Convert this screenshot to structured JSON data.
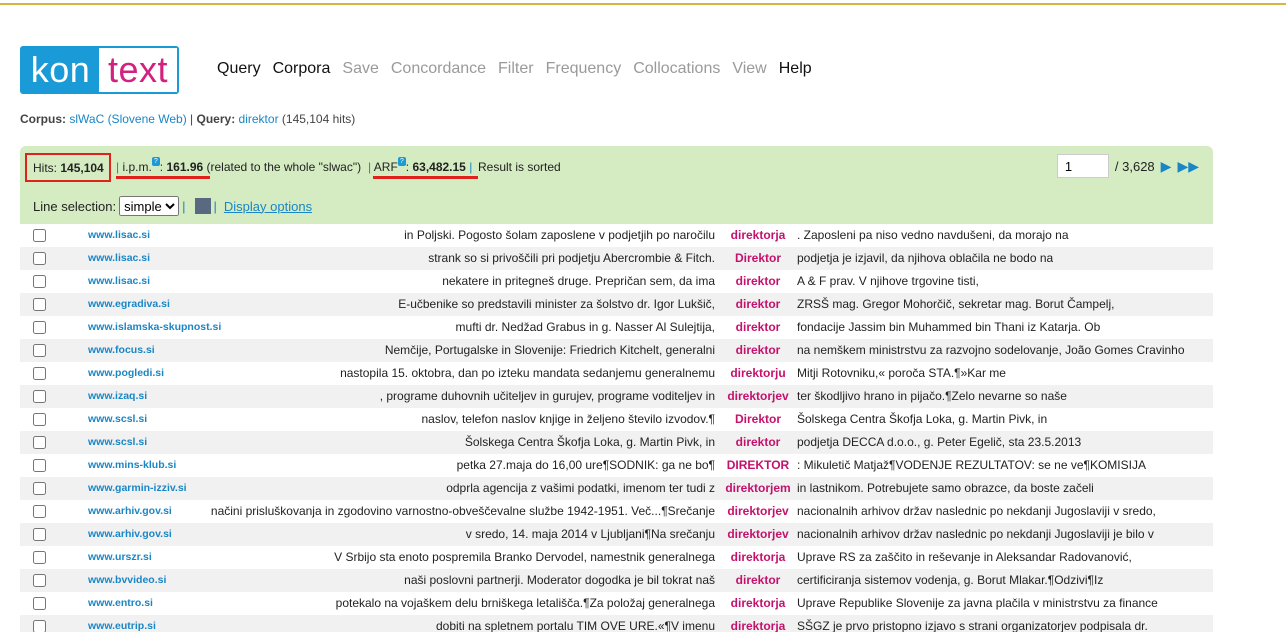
{
  "logo": {
    "part1": "kon",
    "part2": "text"
  },
  "nav": [
    {
      "label": "Query",
      "enabled": true
    },
    {
      "label": "Corpora",
      "enabled": true
    },
    {
      "label": "Save",
      "enabled": false
    },
    {
      "label": "Concordance",
      "enabled": false
    },
    {
      "label": "Filter",
      "enabled": false
    },
    {
      "label": "Frequency",
      "enabled": false
    },
    {
      "label": "Collocations",
      "enabled": false
    },
    {
      "label": "View",
      "enabled": false
    },
    {
      "label": "Help",
      "enabled": true
    }
  ],
  "crumb": {
    "corpus_label": "Corpus:",
    "corpus_value": "slWaC (Slovene Web)",
    "sep": " | ",
    "query_label": "Query:",
    "query_value": "direktor",
    "hits_note": "(145,104 hits)"
  },
  "stats": {
    "hits_label": "Hits:",
    "hits_value": "145,104",
    "ipm_label": "i.p.m.",
    "ipm_value": "161.96",
    "ipm_note": "(related to the whole \"slwac\")",
    "arf_label": "ARF",
    "arf_value": "63,482.15",
    "sorted": "Result is sorted",
    "help_glyph": "?"
  },
  "pager": {
    "page": "1",
    "total": "/ 3,628"
  },
  "selection": {
    "label": "Line selection:",
    "mode": "simple",
    "display_options": "Display options"
  },
  "colors": {
    "accent": "#1a86c6",
    "keyword": "#c4126c",
    "panel": "#d5ecc2",
    "highlight": "#e0221d"
  },
  "rows": [
    {
      "site": "www.lisac.si",
      "left": "in Poljski. Pogosto šolam zaposlene v podjetjih po naročilu",
      "kw": "direktorja",
      "right": ". Zaposleni pa niso vedno navdušeni, da morajo na"
    },
    {
      "site": "www.lisac.si",
      "left": "strank so si privoščili pri podjetju Abercrombie & Fitch.",
      "kw": "Direktor",
      "right": "podjetja je izjavil, da njihova oblačila ne bodo na"
    },
    {
      "site": "www.lisac.si",
      "left": "nekatere in pritegneš druge. Prepričan sem, da ima",
      "kw": "direktor",
      "right": "A & F prav. V njihove trgovine tisti,"
    },
    {
      "site": "www.egradiva.si",
      "left": "E-učbenike so predstavili minister za šolstvo dr. Igor Lukšič,",
      "kw": "direktor",
      "right": "ZRSŠ mag. Gregor Mohorčič, sekretar mag. Borut Čampelj,"
    },
    {
      "site": "www.islamska-skupnost.si",
      "left": "mufti dr. Nedžad Grabus in g. Nasser Al Sulejtija,",
      "kw": "direktor",
      "right": "fondacije Jassim bin Muhammed bin Thani iz Katarja. Ob"
    },
    {
      "site": "www.focus.si",
      "left": "Nemčije, Portugalske in Slovenije: Friedrich Kitchelt, generalni",
      "kw": "direktor",
      "right": "na nemškem ministrstvu za razvojno sodelovanje, João Gomes Cravinho"
    },
    {
      "site": "www.pogledi.si",
      "left": "nastopila 15. oktobra, dan po izteku mandata sedanjemu generalnemu",
      "kw": "direktorju",
      "right": "Mitji Rotovniku,« poroča STA.¶»Kar me"
    },
    {
      "site": "www.izaq.si",
      "left": ", programe duhovnih učiteljev in gurujev, programe voditeljev in",
      "kw": "direktorjev",
      "right": "ter škodljivo hrano in pijačo.¶Zelo nevarne so naše"
    },
    {
      "site": "www.scsl.si",
      "left": "naslov, telefon naslov knjige in željeno število izvodov.¶",
      "kw": "Direktor",
      "right": "Šolskega Centra Škofja Loka, g. Martin Pivk, in"
    },
    {
      "site": "www.scsl.si",
      "left": "Šolskega Centra Škofja Loka, g. Martin Pivk, in",
      "kw": "direktor",
      "right": "podjetja DECCA d.o.o., g. Peter Egelič, sta 23.5.2013"
    },
    {
      "site": "www.mins-klub.si",
      "left": "petka 27.maja do 16,00 ure¶SODNIK: ga ne bo¶",
      "kw": "DIREKTOR",
      "right": ": Mikuletič Matjaž¶VODENJE REZULTATOV: se ne ve¶KOMISIJA"
    },
    {
      "site": "www.garmin-izziv.si",
      "left": "odprla agencija z vašimi podatki, imenom ter tudi z",
      "kw": "direktorjem",
      "right": "in lastnikom. Potrebujete samo obrazce, da boste začeli"
    },
    {
      "site": "www.arhiv.gov.si",
      "left": "načini prisluškovanja in zgodovino varnostno-obveščevalne službe 1942-1951. Več...¶Srečanje",
      "kw": "direktorjev",
      "right": "nacionalnih arhivov držav naslednic po nekdanji Jugoslaviji v sredo,"
    },
    {
      "site": "www.arhiv.gov.si",
      "left": "v sredo, 14. maja 2014 v Ljubljani¶Na srečanju",
      "kw": "direktorjev",
      "right": "nacionalnih arhivov držav naslednic po nekdanji Jugoslaviji je bilo v"
    },
    {
      "site": "www.urszr.si",
      "left": "V Srbijo sta enoto pospremila Branko Dervodel, namestnik generalnega",
      "kw": "direktorja",
      "right": "Uprave RS za zaščito in reševanje in Aleksandar Radovanović,"
    },
    {
      "site": "www.bvvideo.si",
      "left": "naši poslovni partnerji. Moderator dogodka je bil tokrat naš",
      "kw": "direktor",
      "right": "certificiranja sistemov vodenja, g. Borut Mlakar.¶Odzivi¶Iz"
    },
    {
      "site": "www.entro.si",
      "left": "potekalo na vojaškem delu brniškega letališča.¶Za položaj generalnega",
      "kw": "direktorja",
      "right": "Uprave Republike Slovenije za javna plačila v ministrstvu za finance"
    },
    {
      "site": "www.eutrip.si",
      "left": "dobiti na spletnem portalu TIM OVE URE.«¶V imenu",
      "kw": "direktorja",
      "right": "SŠGZ je prvo pristopno izjavo s strani organizatorjev podpisala dr."
    }
  ]
}
